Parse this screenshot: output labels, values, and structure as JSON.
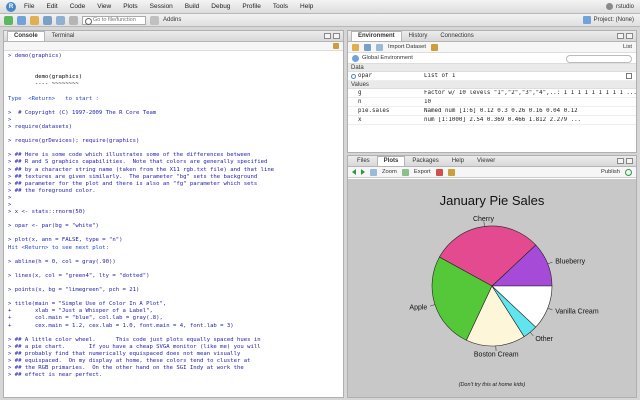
{
  "app": {
    "menus": [
      "File",
      "Edit",
      "Code",
      "View",
      "Plots",
      "Session",
      "Build",
      "Debug",
      "Profile",
      "Tools",
      "Help"
    ],
    "user": "rstudio",
    "colors": {
      "accent": "#4a87c6",
      "green": "#2a9a3a"
    }
  },
  "toolbar": {
    "goto_placeholder": "Go to file/function",
    "addins_label": "Addins",
    "project_label": "Project: (None)"
  },
  "console": {
    "tabs": [
      "Console",
      "Terminal"
    ],
    "lines": [
      {
        "t": "> demo(graphics)",
        "c": "prompt"
      },
      {
        "t": "",
        "c": "out"
      },
      {
        "t": "",
        "c": "out"
      },
      {
        "t": "        demo(graphics)",
        "c": "out"
      },
      {
        "t": "        ---- ~~~~~~~~",
        "c": "out"
      },
      {
        "t": "",
        "c": "out"
      },
      {
        "t": "Type  <Return>   to start :",
        "c": "blue"
      },
      {
        "t": "",
        "c": "out"
      },
      {
        "t": ">  # Copyright (C) 1997-2009 The R Core Team",
        "c": "prompt"
      },
      {
        "t": ">",
        "c": "prompt"
      },
      {
        "t": "> require(datasets)",
        "c": "prompt"
      },
      {
        "t": "",
        "c": "out"
      },
      {
        "t": "> require(grDevices); require(graphics)",
        "c": "prompt"
      },
      {
        "t": "",
        "c": "out"
      },
      {
        "t": "> ## Here is some code which illustrates some of the differences between",
        "c": "prompt"
      },
      {
        "t": "> ## R and S graphics capabilities.  Note that colors are generally specified",
        "c": "prompt"
      },
      {
        "t": "> ## by a character string name (taken from the X11 rgb.txt file) and that line",
        "c": "prompt"
      },
      {
        "t": "> ## textures are given similarly.  The parameter \"bg\" sets the background",
        "c": "prompt"
      },
      {
        "t": "> ## parameter for the plot and there is also an \"fg\" parameter which sets",
        "c": "prompt"
      },
      {
        "t": "> ## the foreground color.",
        "c": "prompt"
      },
      {
        "t": ">",
        "c": "prompt"
      },
      {
        "t": ">",
        "c": "prompt"
      },
      {
        "t": "> x <- stats::rnorm(50)",
        "c": "prompt"
      },
      {
        "t": "",
        "c": "out"
      },
      {
        "t": "> opar <- par(bg = \"white\")",
        "c": "prompt"
      },
      {
        "t": "",
        "c": "out"
      },
      {
        "t": "> plot(x, ann = FALSE, type = \"n\")",
        "c": "prompt"
      },
      {
        "t": "Hit <Return> to see next plot:",
        "c": "blue"
      },
      {
        "t": "",
        "c": "out"
      },
      {
        "t": "> abline(h = 0, col = gray(.90))",
        "c": "prompt"
      },
      {
        "t": "",
        "c": "out"
      },
      {
        "t": "> lines(x, col = \"green4\", lty = \"dotted\")",
        "c": "prompt"
      },
      {
        "t": "",
        "c": "out"
      },
      {
        "t": "> points(x, bg = \"limegreen\", pch = 21)",
        "c": "prompt"
      },
      {
        "t": "",
        "c": "out"
      },
      {
        "t": "> title(main = \"Simple Use of Color In A Plot\",",
        "c": "prompt"
      },
      {
        "t": "+       xlab = \"Just a Whisper of a Label\",",
        "c": "prompt"
      },
      {
        "t": "+       col.main = \"blue\", col.lab = gray(.8),",
        "c": "prompt"
      },
      {
        "t": "+       cex.main = 1.2, cex.lab = 1.0, font.main = 4, font.lab = 3)",
        "c": "prompt"
      },
      {
        "t": "",
        "c": "out"
      },
      {
        "t": "> ## A little color wheel.      This code just plots equally spaced hues in",
        "c": "prompt"
      },
      {
        "t": "> ## a pie chart.       If you have a cheap SVGA monitor (like me) you will",
        "c": "prompt"
      },
      {
        "t": "> ## probably find that numerically equispaced does not mean visually",
        "c": "prompt"
      },
      {
        "t": "> ## equispaced.  On my display at home, these colors tend to cluster at",
        "c": "prompt"
      },
      {
        "t": "> ## the RGB primaries.  On the other hand on the SGI Indy at work the",
        "c": "prompt"
      },
      {
        "t": "> ## effect is near perfect.",
        "c": "prompt"
      }
    ]
  },
  "environment": {
    "tabs": [
      "Environment",
      "History",
      "Connections"
    ],
    "import_label": "Import Dataset",
    "list_label": "List",
    "scope_label": "Global Environment",
    "data_header": "Data",
    "values_header": "Values",
    "data_rows": [
      {
        "name": "opar",
        "value": "List of 1"
      }
    ],
    "value_rows": [
      {
        "name": "g",
        "value": "Factor w/ 10 levels \"1\",\"2\",\"3\",\"4\",..: 1 1 1 1 1 1 1 1 1 ..."
      },
      {
        "name": "n",
        "value": "10"
      },
      {
        "name": "pie.sales",
        "value": "Named num [1:6] 0.12 0.3 0.26 0.16 0.04 0.12"
      },
      {
        "name": "x",
        "value": "num [1:1000] 2.54 0.369 0.466 1.812 2.279 ..."
      }
    ]
  },
  "plots": {
    "tabs": [
      "Files",
      "Plots",
      "Packages",
      "Help",
      "Viewer"
    ],
    "zoom_label": "Zoom",
    "export_label": "Export",
    "publish_label": "Publish",
    "chart_data": {
      "type": "pie",
      "title": "January Pie Sales",
      "subtitle": "(Don't try this at home kids)",
      "categories": [
        "Blueberry",
        "Cherry",
        "Apple",
        "Boston Cream",
        "Other",
        "Vanilla Cream"
      ],
      "values": [
        0.12,
        0.3,
        0.26,
        0.16,
        0.04,
        0.12
      ],
      "colors": [
        "#a64ad8",
        "#e44a8f",
        "#55c83a",
        "#fdf6d8",
        "#60e4ee",
        "#ffffff"
      ],
      "start_angle_deg": 0,
      "direction": "counterclockwise"
    }
  }
}
